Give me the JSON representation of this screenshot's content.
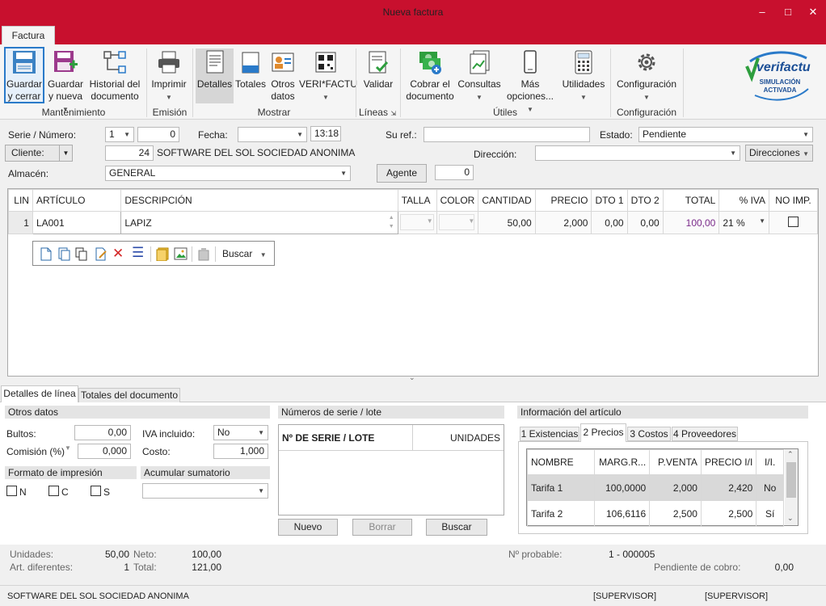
{
  "window": {
    "title": "Nueva factura"
  },
  "ribbon": {
    "tab": "Factura",
    "groups": {
      "mantenimiento": "Mantenimiento",
      "emision": "Emisión",
      "mostrar": "Mostrar",
      "lineas": "Líneas",
      "utiles": "Útiles",
      "configuracion": "Configuración"
    },
    "buttons": {
      "guardar_cerrar": [
        "Guardar",
        "y cerrar"
      ],
      "guardar_nueva": [
        "Guardar",
        "y nueva"
      ],
      "historial": [
        "Historial del",
        "documento"
      ],
      "imprimir": "Imprimir",
      "detalles": "Detalles",
      "totales": "Totales",
      "otros_datos": [
        "Otros",
        "datos"
      ],
      "verifactu": "VERI*FACTU",
      "validar": "Validar",
      "cobrar": [
        "Cobrar el",
        "documento"
      ],
      "consultas": "Consultas",
      "mas_opciones": [
        "Más",
        "opciones..."
      ],
      "utilidades": "Utilidades",
      "configuracion": "Configuración"
    },
    "badge": {
      "logo": "verifactu",
      "line1": "SIMULACIÓN",
      "line2": "ACTIVADA"
    }
  },
  "header": {
    "serie_label": "Serie / Número:",
    "serie": "1",
    "numero": "0",
    "fecha_label": "Fecha:",
    "fecha": "",
    "hora": "13:18",
    "suref_label": "Su ref.:",
    "suref": "",
    "estado_label": "Estado:",
    "estado": "Pendiente",
    "cliente_label": "Cliente:",
    "cliente_code": "24",
    "cliente_name": "SOFTWARE DEL SOL SOCIEDAD ANONIMA",
    "direccion_label": "Dirección:",
    "direcciones_btn": "Direcciones",
    "almacen_label": "Almacén:",
    "almacen": "GENERAL",
    "agente_btn": "Agente",
    "agente_value": "0"
  },
  "lines": {
    "columns": [
      "LIN",
      "ARTÍCULO",
      "DESCRIPCIÓN",
      "TALLA",
      "COLOR",
      "CANTIDAD",
      "PRECIO",
      "DTO 1",
      "DTO 2",
      "TOTAL",
      "% IVA",
      "NO IMP."
    ],
    "rows": [
      {
        "lin": "1",
        "articulo": "LA001",
        "descripcion": "LAPIZ",
        "talla": "",
        "color": "",
        "cantidad": "50,00",
        "precio": "2,000",
        "dto1": "0,00",
        "dto2": "0,00",
        "total": "100,00",
        "iva": "21 %",
        "noimp": false
      }
    ],
    "toolbar_search": "Buscar"
  },
  "bottom_tabs": [
    "Detalles de línea",
    "Totales del documento"
  ],
  "otros_datos": {
    "title": "Otros datos",
    "bultos_label": "Bultos:",
    "bultos": "0,00",
    "comision_label": "Comisión (%)",
    "comision": "0,000",
    "iva_incl_label": "IVA incluido:",
    "iva_incl": "No",
    "costo_label": "Costo:",
    "costo": "1,000",
    "formato_title": "Formato de impresión",
    "formato_opts": [
      "N",
      "C",
      "S"
    ],
    "acumular_title": "Acumular sumatorio",
    "acumular": ""
  },
  "series_lote": {
    "title": "Números de serie / lote",
    "col1": "Nº DE SERIE / LOTE",
    "col2": "UNIDADES",
    "btn_nuevo": "Nuevo",
    "btn_borrar": "Borrar",
    "btn_buscar": "Buscar"
  },
  "info_articulo": {
    "title": "Información del artículo",
    "tabs": [
      "1 Existencias",
      "2 Precios",
      "3 Costos",
      "4 Proveedores"
    ],
    "columns": [
      "NOMBRE",
      "MARG.R...",
      "P.VENTA",
      "PRECIO I/I",
      "I/I."
    ],
    "rows": [
      {
        "nombre": "Tarifa 1",
        "marg": "100,0000",
        "pventa": "2,000",
        "precio_ii": "2,420",
        "ii": "No"
      },
      {
        "nombre": "Tarifa 2",
        "marg": "106,6116",
        "pventa": "2,500",
        "precio_ii": "2,500",
        "ii": "Sí"
      }
    ]
  },
  "summary": {
    "unidades_label": "Unidades:",
    "unidades": "50,00",
    "art_dif_label": "Art. diferentes:",
    "art_dif": "1",
    "neto_label": "Neto:",
    "neto": "100,00",
    "total_label": "Total:",
    "total": "121,00",
    "nprob_label": "Nº probable:",
    "nprob": "1 - 000005",
    "pend_label": "Pendiente de cobro:",
    "pend": "0,00"
  },
  "statusbar": {
    "company": "SOFTWARE DEL SOL SOCIEDAD ANONIMA",
    "user1": "[SUPERVISOR]",
    "user2": "[SUPERVISOR]"
  },
  "colors": {
    "accent": "#c8102e",
    "selected_button": "#d6d6d6",
    "total_text": "#7a2a8a"
  }
}
